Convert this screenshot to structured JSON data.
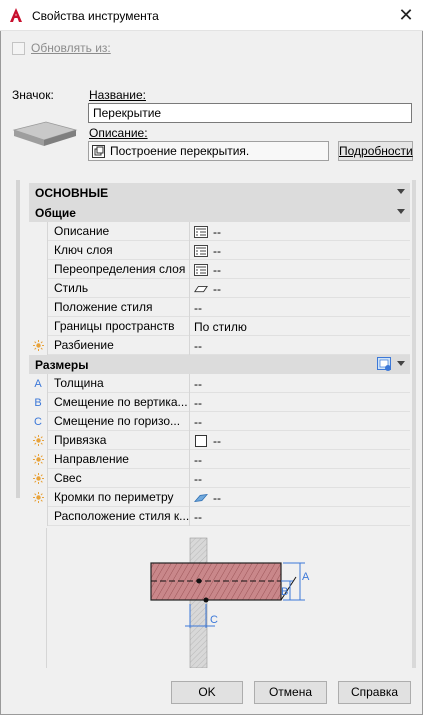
{
  "window": {
    "title": "Свойства инструмента",
    "close_glyph": "✕"
  },
  "update_from": {
    "label": "Обновлять из:",
    "checked": false
  },
  "icon_label": "Значок:",
  "name": {
    "label": "Название:",
    "value": "Перекрытие"
  },
  "description": {
    "label": "Описание:",
    "value": "Построение перекрытия."
  },
  "details_button": "Подробности",
  "properties": {
    "main_header": "ОСНОВНЫЕ",
    "general_header": "Общие",
    "general_rows": [
      {
        "name": "Описание",
        "value": "--",
        "icon": "list-icon"
      },
      {
        "name": "Ключ слоя",
        "value": "--",
        "icon": "list-icon"
      },
      {
        "name": "Переопределения слоя",
        "value": "--",
        "icon": "list-icon"
      },
      {
        "name": "Стиль",
        "value": "--",
        "icon": "slab-style-icon"
      },
      {
        "name": "Положение стиля",
        "value": "--",
        "icon": ""
      },
      {
        "name": "Границы пространств",
        "value": "По стилю",
        "icon": ""
      },
      {
        "name": "Разбиение",
        "value": "--",
        "icon": "",
        "gutter": "sun-icon"
      }
    ],
    "dimensions_header": "Размеры",
    "dimension_rows": [
      {
        "name": "Толщина",
        "value": "--",
        "gutter_letter": "A"
      },
      {
        "name": "Смещение  по  вертика...",
        "value": "--",
        "gutter_letter": "B"
      },
      {
        "name": "Смещение  по  горизо...",
        "value": "--",
        "gutter_letter": "C"
      },
      {
        "name": "Привязка",
        "value": "--",
        "gutter": "sun-icon",
        "icon": "square-icon"
      },
      {
        "name": "Направление",
        "value": "--",
        "gutter": "sun-icon"
      },
      {
        "name": "Свес",
        "value": "--",
        "gutter": "sun-icon"
      },
      {
        "name": "Кромки по периметру",
        "value": "--",
        "gutter": "sun-icon",
        "icon": "edge-icon"
      },
      {
        "name": "Расположение стиля к...",
        "value": "--"
      }
    ]
  },
  "diagram_labels": {
    "a": "A",
    "b": "B",
    "c": "C"
  },
  "buttons": {
    "ok": "OK",
    "cancel": "Отмена",
    "help": "Справка"
  },
  "colors": {
    "slab_fill": "#c9878a",
    "dim_blue": "#3c78d8",
    "column_gray": "#d8d8d8"
  }
}
